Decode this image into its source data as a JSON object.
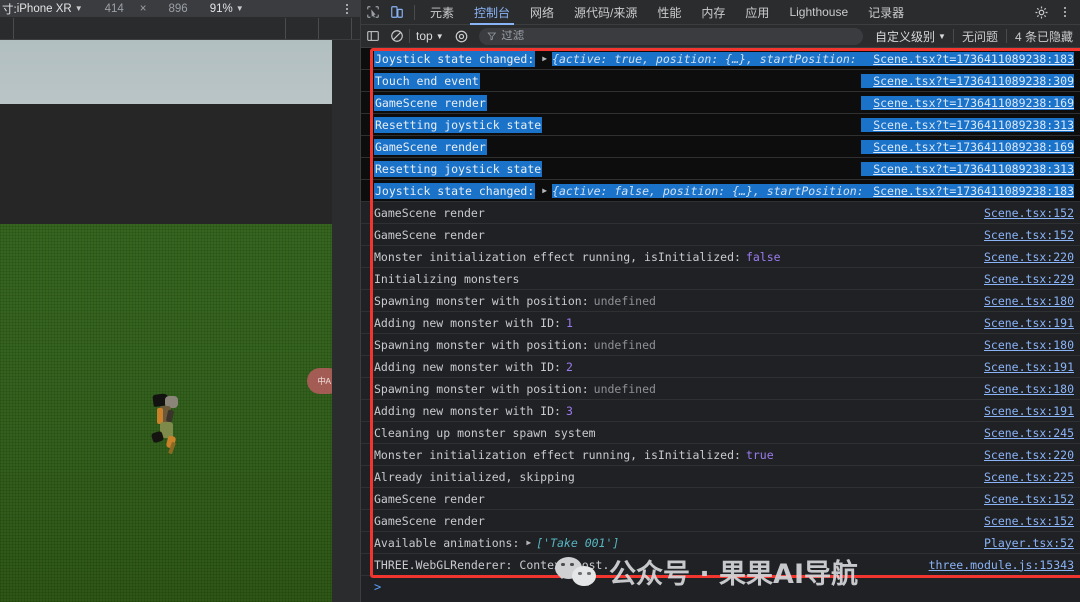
{
  "device_toolbar": {
    "label_prefix": "寸: ",
    "device": "iPhone XR",
    "width": "414",
    "times": "×",
    "height": "896",
    "zoom": "91%",
    "caret": "▼",
    "more_icon": "kebab-menu-icon"
  },
  "viewport": {
    "translate_button_line1": "中",
    "translate_button_line2": "A"
  },
  "devtools": {
    "tabs": [
      {
        "label": "元素",
        "active": false
      },
      {
        "label": "控制台",
        "active": true
      },
      {
        "label": "网络",
        "active": false
      },
      {
        "label": "源代码/来源",
        "active": false
      },
      {
        "label": "性能",
        "active": false
      },
      {
        "label": "内存",
        "active": false
      },
      {
        "label": "应用",
        "active": false
      },
      {
        "label": "Lighthouse",
        "active": false
      },
      {
        "label": "记录器",
        "active": false
      }
    ],
    "inspect_icon": "inspect-element-icon",
    "device_toggle_icon": "device-toolbar-toggle-icon",
    "settings_icon": "gear-icon",
    "more_icon": "kebab-menu-icon"
  },
  "console_toolbar": {
    "sidebar_icon": "console-sidebar-icon",
    "clear_icon": "clear-console-icon",
    "context": "top",
    "context_caret": "▼",
    "eye_icon": "live-expression-icon",
    "filter_icon": "filter-icon",
    "filter_value": "",
    "filter_placeholder": "过滤",
    "level": "自定义级别",
    "level_caret": "▼",
    "issues": "无问题",
    "hidden_count": "4 条已隐藏"
  },
  "console_logs": [
    {
      "text": "Joystick state changed:",
      "selected": true,
      "expandable": true,
      "preview": "{active: true, position: {…}, startPosition: {…}}",
      "source": "Scene.tsx?t=1736411089238:183"
    },
    {
      "text": "Touch end event",
      "selected": true,
      "expandable": false,
      "source": "Scene.tsx?t=1736411089238:309"
    },
    {
      "text": "GameScene render",
      "selected": true,
      "expandable": false,
      "source": "Scene.tsx?t=1736411089238:169"
    },
    {
      "text": "Resetting joystick state",
      "selected": true,
      "expandable": false,
      "source": "Scene.tsx?t=1736411089238:313"
    },
    {
      "text": "GameScene render",
      "selected": true,
      "expandable": false,
      "source": "Scene.tsx?t=1736411089238:169"
    },
    {
      "text": "Resetting joystick state",
      "selected": true,
      "expandable": false,
      "source": "Scene.tsx?t=1736411089238:313"
    },
    {
      "text": "Joystick state changed:",
      "selected": true,
      "expandable": true,
      "preview": "{active: false, position: {…}, startPosition: {…}}",
      "source": "Scene.tsx?t=1736411089238:183"
    },
    {
      "text": "GameScene render",
      "selected": false,
      "expandable": false,
      "source": "Scene.tsx:152"
    },
    {
      "text": "GameScene render",
      "selected": false,
      "expandable": false,
      "source": "Scene.tsx:152"
    },
    {
      "text": "Monster initialization effect running, isInitialized:",
      "value": "false",
      "value_type": "bool",
      "selected": false,
      "expandable": false,
      "source": "Scene.tsx:220"
    },
    {
      "text": "Initializing monsters",
      "selected": false,
      "expandable": false,
      "source": "Scene.tsx:229"
    },
    {
      "text": "Spawning monster with position:",
      "value": "undefined",
      "value_type": "undef",
      "selected": false,
      "expandable": false,
      "source": "Scene.tsx:180"
    },
    {
      "text": "Adding new monster with ID:",
      "value": "1",
      "value_type": "num",
      "selected": false,
      "expandable": false,
      "source": "Scene.tsx:191"
    },
    {
      "text": "Spawning monster with position:",
      "value": "undefined",
      "value_type": "undef",
      "selected": false,
      "expandable": false,
      "source": "Scene.tsx:180"
    },
    {
      "text": "Adding new monster with ID:",
      "value": "2",
      "value_type": "num",
      "selected": false,
      "expandable": false,
      "source": "Scene.tsx:191"
    },
    {
      "text": "Spawning monster with position:",
      "value": "undefined",
      "value_type": "undef",
      "selected": false,
      "expandable": false,
      "source": "Scene.tsx:180"
    },
    {
      "text": "Adding new monster with ID:",
      "value": "3",
      "value_type": "num",
      "selected": false,
      "expandable": false,
      "source": "Scene.tsx:191"
    },
    {
      "text": "Cleaning up monster spawn system",
      "selected": false,
      "expandable": false,
      "source": "Scene.tsx:245"
    },
    {
      "text": "Monster initialization effect running, isInitialized:",
      "value": "true",
      "value_type": "bool",
      "selected": false,
      "expandable": false,
      "source": "Scene.tsx:220"
    },
    {
      "text": "Already initialized, skipping",
      "selected": false,
      "expandable": false,
      "source": "Scene.tsx:225"
    },
    {
      "text": "GameScene render",
      "selected": false,
      "expandable": false,
      "source": "Scene.tsx:152"
    },
    {
      "text": "GameScene render",
      "selected": false,
      "expandable": false,
      "source": "Scene.tsx:152"
    },
    {
      "text": "Available animations:",
      "selected": false,
      "expandable": true,
      "array_preview": "['Take 001']",
      "source": "Player.tsx:52"
    },
    {
      "text": "THREE.WebGLRenderer: Context Lost.",
      "selected": false,
      "expandable": false,
      "source": "three.module.js:15343"
    }
  ],
  "console_prompt": ">",
  "watermark": {
    "icon": "wechat-icon",
    "text": "公众号 · 果果AI导航"
  },
  "colors": {
    "accent_blue": "#8ab4f8",
    "selection_blue": "#1a73c8",
    "annotation_red": "#f2352e",
    "literal_purple": "#9a7cf0",
    "string_cyan": "#56b6c2"
  }
}
